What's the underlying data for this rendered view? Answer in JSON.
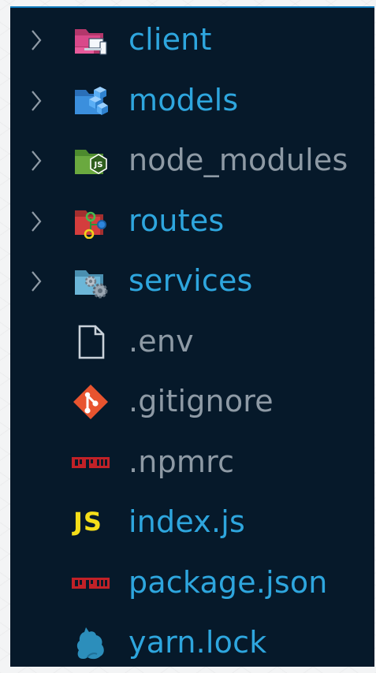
{
  "explorer": {
    "items": [
      {
        "label": "client",
        "kind": "folder",
        "icon": "folder-client-icon"
      },
      {
        "label": "models",
        "kind": "folder",
        "icon": "folder-models-icon"
      },
      {
        "label": "node_modules",
        "kind": "folder",
        "icon": "folder-node-icon"
      },
      {
        "label": "routes",
        "kind": "folder",
        "icon": "folder-routes-icon"
      },
      {
        "label": "services",
        "kind": "folder",
        "icon": "folder-services-icon"
      },
      {
        "label": ".env",
        "kind": "file",
        "icon": "file-icon"
      },
      {
        "label": ".gitignore",
        "kind": "file",
        "icon": "git-icon"
      },
      {
        "label": ".npmrc",
        "kind": "file",
        "icon": "npm-icon"
      },
      {
        "label": "index.js",
        "kind": "file",
        "icon": "javascript-icon",
        "badge": "JS"
      },
      {
        "label": "package.json",
        "kind": "file",
        "icon": "npm-icon"
      },
      {
        "label": "yarn.lock",
        "kind": "file",
        "icon": "yarn-icon"
      }
    ]
  },
  "colors": {
    "background": "#06192a",
    "folder_label": "#2ea6de",
    "muted_label": "#8e9aa5",
    "accent_border": "#0f7bbd",
    "js_yellow": "#f5de19",
    "git_orange": "#e8542f",
    "npm_red": "#c12127"
  }
}
